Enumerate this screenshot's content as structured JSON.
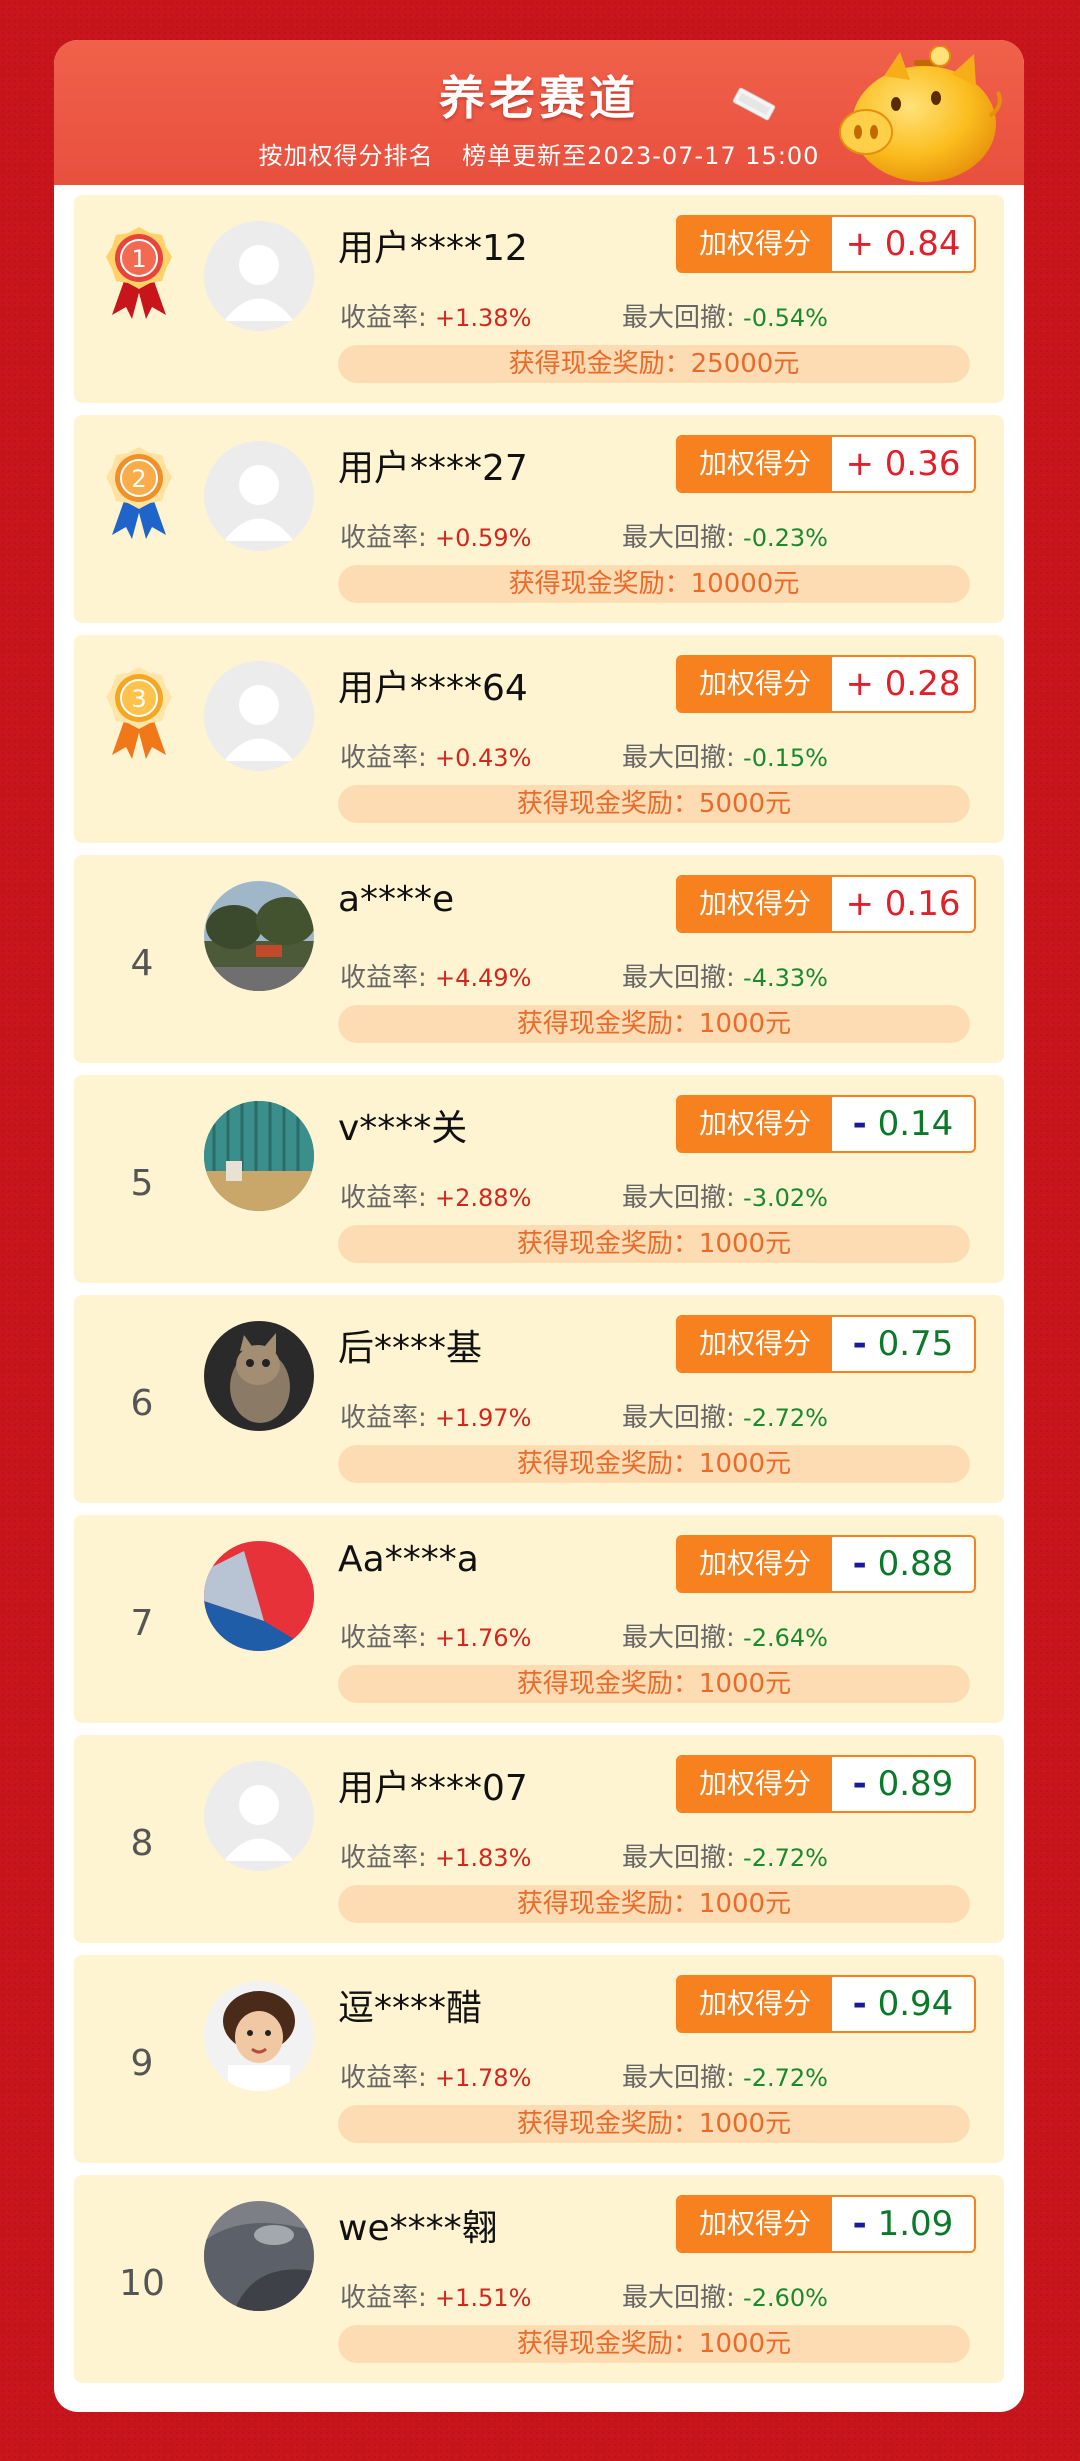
{
  "header": {
    "title": "养老赛道",
    "sort_text": "按加权得分排名",
    "update_text": "榜单更新至2023-07-17 15:00"
  },
  "labels": {
    "score_label": "加权得分",
    "return_label": "收益率:",
    "drawdown_label": "最大回撤:",
    "reward_prefix": "获得现金奖励:"
  },
  "colors": {
    "accent": "#f6811e",
    "header_red": "#e8503e",
    "row_bg": "#fff4d2",
    "positive": "#e0202a",
    "negative": "#0a7a2a"
  },
  "rows": [
    {
      "rank": "1",
      "medal": "gold-red-medal-1",
      "avatar": "default-avatar",
      "name": "用户****12",
      "score_sign": "+",
      "score": "0.84",
      "return": "+1.38%",
      "drawdown": "-0.54%",
      "reward": "获得现金奖励：25000元"
    },
    {
      "rank": "2",
      "medal": "blue-medal-2",
      "avatar": "default-avatar",
      "name": "用户****27",
      "score_sign": "+",
      "score": "0.36",
      "return": "+0.59%",
      "drawdown": "-0.23%",
      "reward": "获得现金奖励：10000元"
    },
    {
      "rank": "3",
      "medal": "orange-medal-3",
      "avatar": "default-avatar",
      "name": "用户****64",
      "score_sign": "+",
      "score": "0.28",
      "return": "+0.43%",
      "drawdown": "-0.15%",
      "reward": "获得现金奖励：5000元"
    },
    {
      "rank": "4",
      "medal": "",
      "avatar": "photo-park-avatar",
      "name": "a****e",
      "score_sign": "+",
      "score": "0.16",
      "return": "+4.49%",
      "drawdown": "-4.33%",
      "reward": "获得现金奖励：1000元"
    },
    {
      "rank": "5",
      "medal": "",
      "avatar": "photo-room-avatar",
      "name": "v****关",
      "score_sign": "-",
      "score": "0.14",
      "return": "+2.88%",
      "drawdown": "-3.02%",
      "reward": "获得现金奖励：1000元"
    },
    {
      "rank": "6",
      "medal": "",
      "avatar": "photo-cat-avatar",
      "name": "后****基",
      "score_sign": "-",
      "score": "0.75",
      "return": "+1.97%",
      "drawdown": "-2.72%",
      "reward": "获得现金奖励：1000元"
    },
    {
      "rank": "7",
      "medal": "",
      "avatar": "logo-avatar",
      "name": "Aa****a",
      "score_sign": "-",
      "score": "0.88",
      "return": "+1.76%",
      "drawdown": "-2.64%",
      "reward": "获得现金奖励：1000元"
    },
    {
      "rank": "8",
      "medal": "",
      "avatar": "default-avatar",
      "name": "用户****07",
      "score_sign": "-",
      "score": "0.89",
      "return": "+1.83%",
      "drawdown": "-2.72%",
      "reward": "获得现金奖励：1000元"
    },
    {
      "rank": "9",
      "medal": "",
      "avatar": "photo-child-avatar",
      "name": "逗****醋",
      "score_sign": "-",
      "score": "0.94",
      "return": "+1.78%",
      "drawdown": "-2.72%",
      "reward": "获得现金奖励：1000元"
    },
    {
      "rank": "10",
      "medal": "",
      "avatar": "photo-gray-avatar",
      "name": "we****翱",
      "score_sign": "-",
      "score": "1.09",
      "return": "+1.51%",
      "drawdown": "-2.60%",
      "reward": "获得现金奖励：1000元"
    }
  ]
}
